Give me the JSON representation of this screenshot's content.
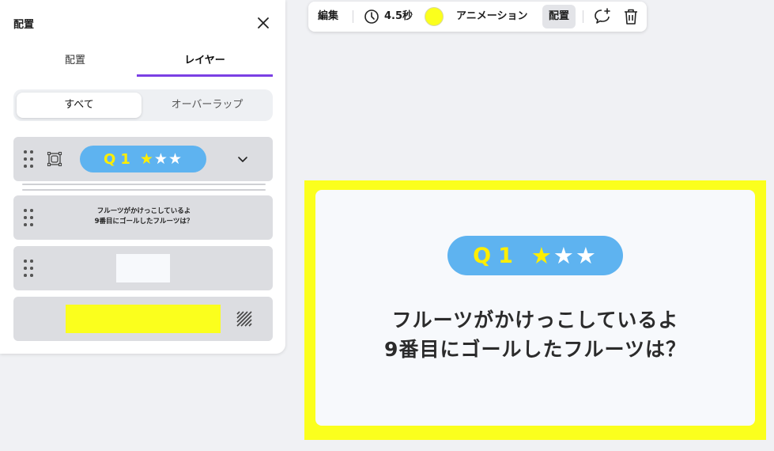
{
  "panel": {
    "title": "配置",
    "close_icon": "close-icon",
    "tabs": [
      {
        "label": "配置",
        "active": false
      },
      {
        "label": "レイヤー",
        "active": true
      }
    ],
    "filters": [
      {
        "label": "すべて",
        "selected": true
      },
      {
        "label": "オーバーラップ",
        "selected": false
      }
    ],
    "layers": [
      {
        "kind": "group",
        "icon": "group-icon",
        "q_label": "Q1",
        "stars": [
          "★",
          "★",
          "★"
        ],
        "expand_icon": "chevron-down-icon"
      },
      {
        "kind": "text",
        "lines": [
          "フルーツがかけっこしているよ",
          "9番目にゴールしたフルーツは？"
        ]
      },
      {
        "kind": "shape",
        "fill": "#f7f9fc"
      },
      {
        "kind": "background",
        "fill": "#fbff1d",
        "icon": "transparency-icon"
      }
    ]
  },
  "toolbar": {
    "edit_label": "編集",
    "clock_icon": "clock-icon",
    "duration_label": "4.5秒",
    "color_value": "#fbff1d",
    "animation_label": "アニメーション",
    "arrange_label": "配置",
    "comment_icon": "comment-add-icon",
    "trash_icon": "trash-icon"
  },
  "canvas": {
    "q_label": "Q1",
    "stars": [
      "★",
      "★",
      "★"
    ],
    "question_lines": [
      "フルーツがかけっこしているよ",
      "9番目にゴールしたフルーツは？"
    ],
    "colors": {
      "frame": "#fbff1d",
      "pill": "#5eb3f0",
      "highlight": "#ffee00",
      "card": "#f7f9fc"
    }
  },
  "accent_color": "#7b3fe4"
}
